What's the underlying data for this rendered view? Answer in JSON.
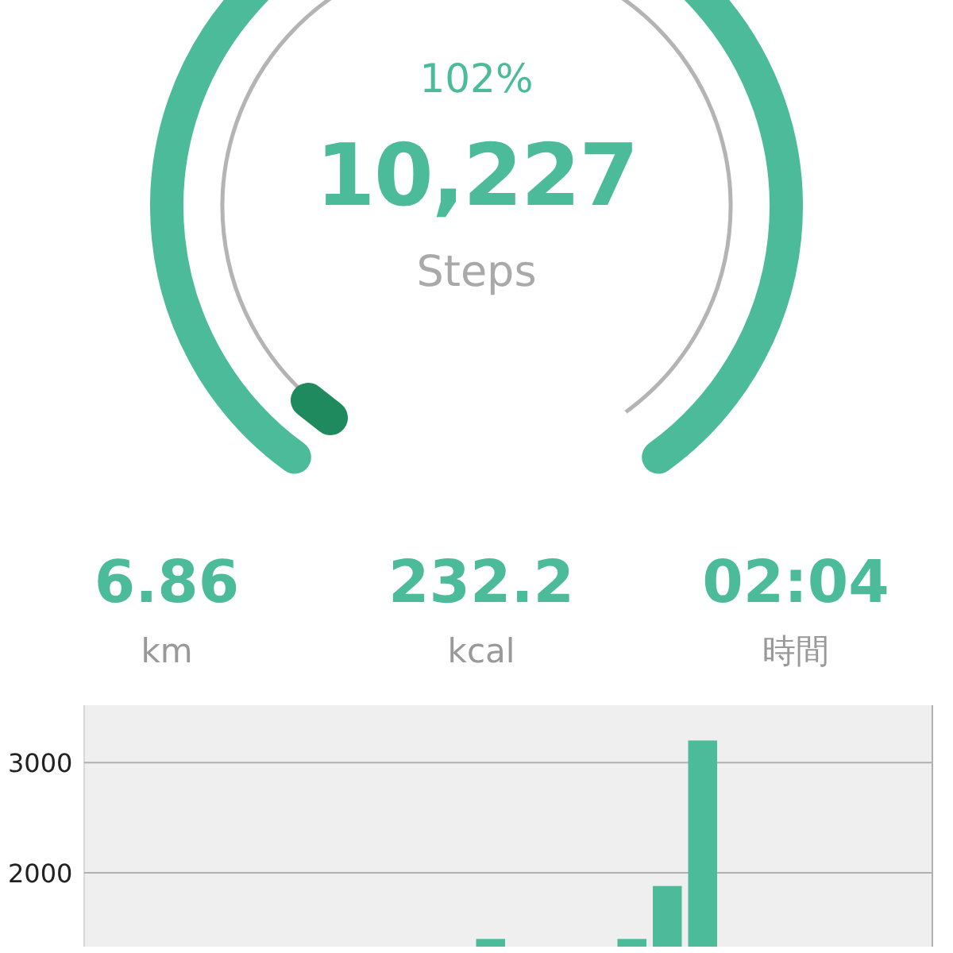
{
  "gauge": {
    "percent": "102%",
    "value": "10,227",
    "unit": "Steps"
  },
  "stats": [
    {
      "value": "6.86",
      "unit": "km"
    },
    {
      "value": "232.2",
      "unit": "kcal"
    },
    {
      "value": "02:04",
      "unit": "時間"
    }
  ],
  "chart_data": {
    "type": "bar",
    "ylim": [
      1330,
      3520
    ],
    "yticks": [
      2000,
      3000
    ],
    "series": [
      {
        "color": "#4cbb9a",
        "values": [
          null,
          null,
          null,
          null,
          null,
          null,
          null,
          null,
          null,
          null,
          null,
          1400,
          null,
          null,
          null,
          1400,
          1880,
          3200,
          null,
          null,
          null,
          null,
          null,
          null
        ]
      }
    ]
  }
}
